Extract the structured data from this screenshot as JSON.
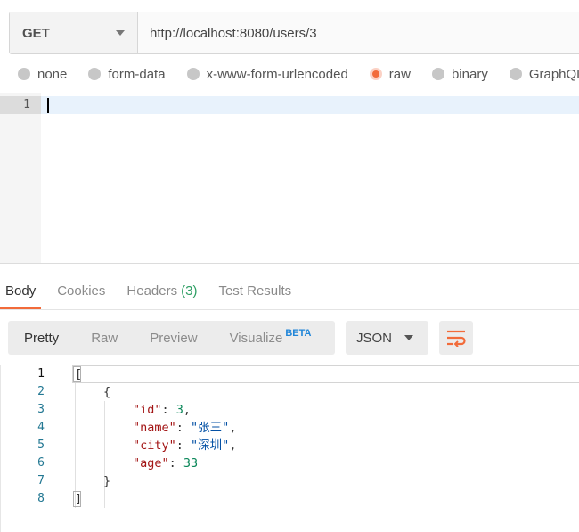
{
  "request": {
    "method": "GET",
    "url": "http://localhost:8080/users/3"
  },
  "body_types": [
    {
      "label": "none",
      "selected": false
    },
    {
      "label": "form-data",
      "selected": false
    },
    {
      "label": "x-www-form-urlencoded",
      "selected": false
    },
    {
      "label": "raw",
      "selected": true
    },
    {
      "label": "binary",
      "selected": false
    },
    {
      "label": "GraphQL",
      "selected": false
    }
  ],
  "request_editor": {
    "line_numbers": [
      "1"
    ]
  },
  "response_tabs": [
    {
      "label": "Body",
      "active": true
    },
    {
      "label": "Cookies",
      "active": false
    },
    {
      "label": "Headers",
      "count": "(3)",
      "active": false
    },
    {
      "label": "Test Results",
      "active": false
    }
  ],
  "view_modes": {
    "pretty": "Pretty",
    "raw": "Raw",
    "preview": "Preview",
    "visualize": "Visualize",
    "beta": "BETA"
  },
  "format": "JSON",
  "response_lines": {
    "numbers": [
      "1",
      "2",
      "3",
      "4",
      "5",
      "6",
      "7",
      "8"
    ],
    "l1": "[",
    "l2": "{",
    "l3_key": "\"id\"",
    "l3_colon": ": ",
    "l3_val": "3",
    "l3_end": ",",
    "l4_key": "\"name\"",
    "l4_colon": ": ",
    "l4_val": "\"张三\"",
    "l4_end": ",",
    "l5_key": "\"city\"",
    "l5_colon": ": ",
    "l5_val": "\"深圳\"",
    "l5_end": ",",
    "l6_key": "\"age\"",
    "l6_colon": ": ",
    "l6_val": "33",
    "l7": "}",
    "l8": "]"
  },
  "colors": {
    "accent": "#f26b3a",
    "json_key": "#a31515",
    "json_string": "#0451a5",
    "json_number": "#098658",
    "headers_count": "#2d9e63",
    "beta": "#1f85d8"
  },
  "icons": {
    "method_dropdown": "chevron-down-icon",
    "format_dropdown": "chevron-down-icon",
    "wrap": "wrap-lines-icon"
  }
}
